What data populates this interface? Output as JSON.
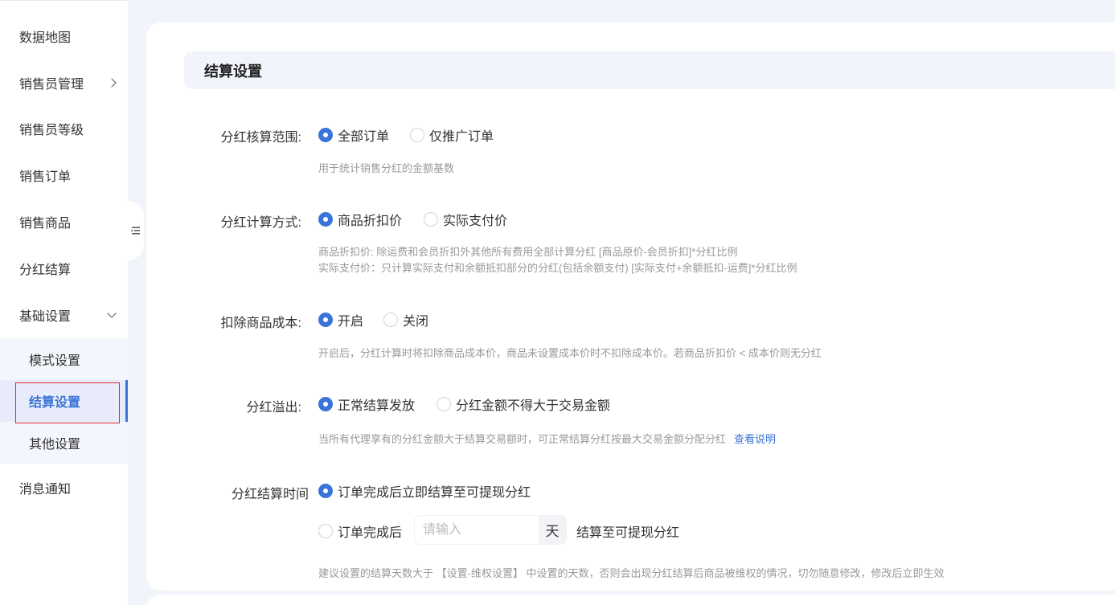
{
  "sidebar": {
    "items": [
      {
        "label": "数据地图"
      },
      {
        "label": "销售员管理"
      },
      {
        "label": "销售员等级"
      },
      {
        "label": "销售订单"
      },
      {
        "label": "销售商品"
      },
      {
        "label": "分红结算"
      },
      {
        "label": "基础设置"
      },
      {
        "label": "消息通知"
      }
    ],
    "sub_items": [
      {
        "label": "模式设置"
      },
      {
        "label": "结算设置",
        "active": true
      },
      {
        "label": "其他设置"
      }
    ]
  },
  "section": {
    "title": "结算设置"
  },
  "form": {
    "scope": {
      "label": "分红核算范围:",
      "options": [
        "全部订单",
        "仅推广订单"
      ],
      "selected": "全部订单",
      "help": "用于统计销售分红的金额基数"
    },
    "calc": {
      "label": "分红计算方式:",
      "options": [
        "商品折扣价",
        "实际支付价"
      ],
      "selected": "商品折扣价",
      "help_line1": "商品折扣价: 除运费和会员折扣外其他所有费用全部计算分红 [商品原价-会员折扣]*分红比例",
      "help_line2": "实际支付价：只计算实际支付和余额抵扣部分的分红(包括余额支付) [实际支付+余额抵扣-运费]*分红比例"
    },
    "cost": {
      "label": "扣除商品成本:",
      "options": [
        "开启",
        "关闭"
      ],
      "selected": "开启",
      "help": "开启后，分红计算时将扣除商品成本价，商品未设置成本价时不扣除成本价。若商品折扣价 < 成本价则无分红"
    },
    "overflow": {
      "label": "分红溢出:",
      "options": [
        "正常结算发放",
        "分红金额不得大于交易金额"
      ],
      "selected": "正常结算发放",
      "help": "当所有代理享有的分红金额大于结算交易额时，可正常结算分红按最大交易金额分配分红",
      "help_link": "查看说明"
    },
    "settle_time": {
      "label": "分红结算时间",
      "option_immediate": "订单完成后立即结算至可提现分红",
      "option_after": "订单完成后",
      "days_placeholder": "请输入",
      "days_value": "",
      "days_unit": "天",
      "after_text": "结算至可提现分红",
      "selected": "订单完成后立即结算至可提现分红",
      "help": "建议设置的结算天数大于 【设置-维权设置】 中设置的天数，否则会出现分红结算后商品被维权的情况，切勿随意修改，修改后立即生效"
    }
  },
  "colors": {
    "accent": "#3b74d8",
    "highlight_box": "#e0282e"
  },
  "icons": {
    "collapse": "menu-collapse-icon"
  }
}
